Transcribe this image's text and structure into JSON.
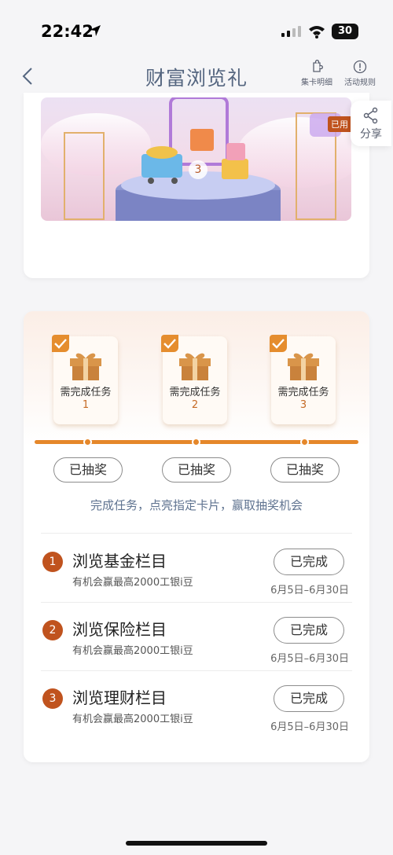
{
  "status": {
    "time": "22:42",
    "battery": "30"
  },
  "header": {
    "title": "财富浏览礼",
    "card_detail": "集卡明细",
    "rules": "活动规则"
  },
  "banner": {
    "used_tag": "已用",
    "number": "3"
  },
  "share": {
    "label": "分享"
  },
  "tasks": [
    {
      "label": "需完成任务",
      "num": "1",
      "status": "已抽奖"
    },
    {
      "label": "需完成任务",
      "num": "2",
      "status": "已抽奖"
    },
    {
      "label": "需完成任务",
      "num": "3",
      "status": "已抽奖"
    }
  ],
  "tip": "完成任务，点亮指定卡片，赢取抽奖机会",
  "rows": [
    {
      "index": "1",
      "title": "浏览基金栏目",
      "sub": "有机会赢最高2000工银i豆",
      "button": "已完成",
      "date": "6月5日–6月30日"
    },
    {
      "index": "2",
      "title": "浏览保险栏目",
      "sub": "有机会赢最高2000工银i豆",
      "button": "已完成",
      "date": "6月5日–6月30日"
    },
    {
      "index": "3",
      "title": "浏览理财栏目",
      "sub": "有机会赢最高2000工银i豆",
      "button": "已完成",
      "date": "6月5日–6月30日"
    }
  ],
  "colors": {
    "accent": "#e5872a",
    "badge": "#c0531e",
    "title": "#556680"
  }
}
